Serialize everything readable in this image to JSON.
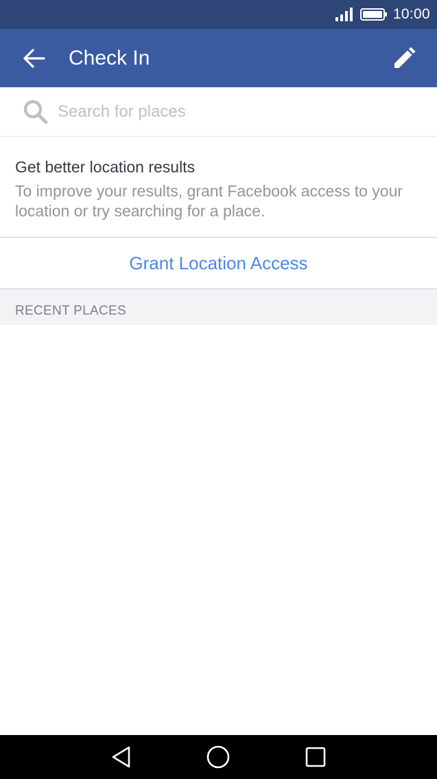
{
  "status_bar": {
    "time": "10:00",
    "icons": [
      "signal-icon",
      "battery-icon"
    ]
  },
  "app_bar": {
    "title": "Check In",
    "back_icon": "arrow-left-icon",
    "edit_icon": "pencil-icon",
    "background": "#3b5ba0"
  },
  "search": {
    "placeholder": "Search for places",
    "value": "",
    "icon": "search-icon"
  },
  "location_prompt": {
    "title": "Get better location results",
    "body": "To improve your results, grant Facebook access to your location or try searching for a place.",
    "action_label": "Grant Location Access",
    "action_color": "#4b88e8"
  },
  "recent_places": {
    "header": "RECENT PLACES",
    "items": []
  },
  "nav_bar": {
    "icons": [
      "nav-back-icon",
      "nav-home-icon",
      "nav-recents-icon"
    ]
  }
}
